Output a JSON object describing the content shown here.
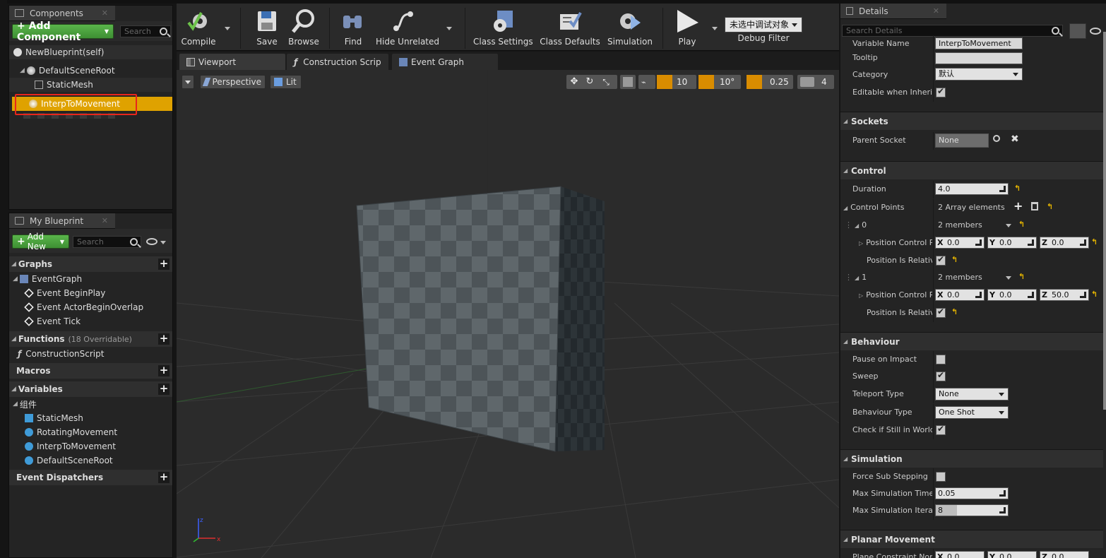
{
  "components_panel": {
    "tab_title": "Components",
    "add_component_label": "+ Add Component",
    "search_placeholder": "Search",
    "self_item": "NewBlueprint(self)",
    "tree": [
      {
        "label": "DefaultSceneRoot"
      },
      {
        "label": "StaticMesh"
      },
      {
        "label": "InterpToMovement",
        "selected": true
      }
    ]
  },
  "my_blueprint": {
    "tab_title": "My Blueprint",
    "add_new_label": "Add New",
    "search_placeholder": "Search",
    "graphs_label": "Graphs",
    "event_graph": "EventGraph",
    "events": [
      "Event BeginPlay",
      "Event ActorBeginOverlap",
      "Event Tick"
    ],
    "functions_label": "Functions",
    "functions_count": "(18 Overridable)",
    "construction_script": "ConstructionScript",
    "macros_label": "Macros",
    "variables_label": "Variables",
    "components_group": "组件",
    "variables": [
      "StaticMesh",
      "RotatingMovement",
      "InterpToMovement",
      "DefaultSceneRoot"
    ],
    "dispatchers_label": "Event Dispatchers"
  },
  "toolbar": {
    "compile": "Compile",
    "save": "Save",
    "browse": "Browse",
    "find": "Find",
    "hide_unrelated": "Hide Unrelated",
    "class_settings": "Class Settings",
    "class_defaults": "Class Defaults",
    "simulation": "Simulation",
    "play": "Play",
    "debug_object": "未选中调试对象",
    "debug_filter": "Debug Filter"
  },
  "doc_tabs": [
    "Viewport",
    "Construction Scrip",
    "Event Graph"
  ],
  "viewport": {
    "perspective": "Perspective",
    "lit": "Lit",
    "grid_snap": "10",
    "rot_snap": "10°",
    "scale_snap": "0.25",
    "camera_speed": "4"
  },
  "details": {
    "tab_title": "Details",
    "search_placeholder": "Search Details",
    "variable_name_label": "Variable Name",
    "variable_name": "InterpToMovement",
    "tooltip_label": "Tooltip",
    "tooltip_value": "",
    "category_label": "Category",
    "category_value": "默认",
    "editable_label": "Editable when Inherited",
    "editable_checked": true,
    "sockets": {
      "title": "Sockets",
      "parent_socket_label": "Parent Socket",
      "parent_socket_value": "None"
    },
    "control": {
      "title": "Control",
      "duration_label": "Duration",
      "duration": "4.0",
      "control_points_label": "Control Points",
      "control_points_value": "2 Array elements",
      "points": [
        {
          "index": "0",
          "members": "2 members",
          "pos_label": "Position Control Point",
          "x": "0.0",
          "y": "0.0",
          "z": "0.0",
          "relative_label": "Position Is Relative",
          "relative": true
        },
        {
          "index": "1",
          "members": "2 members",
          "pos_label": "Position Control Point",
          "x": "0.0",
          "y": "0.0",
          "z": "50.0",
          "relative_label": "Position Is Relative",
          "relative": true
        }
      ]
    },
    "behaviour": {
      "title": "Behaviour",
      "pause_label": "Pause on Impact",
      "pause": false,
      "sweep_label": "Sweep",
      "sweep": true,
      "teleport_label": "Teleport Type",
      "teleport": "None",
      "behaviour_type_label": "Behaviour Type",
      "behaviour_type": "One Shot",
      "check_world_label": "Check if Still in World",
      "check_world": true
    },
    "simulation": {
      "title": "Simulation",
      "force_sub_label": "Force Sub Stepping",
      "force_sub": false,
      "max_time_label": "Max Simulation Time Step",
      "max_time": "0.05",
      "max_iter_label": "Max Simulation Iterations",
      "max_iter": "8"
    },
    "planar": {
      "title": "Planar Movement",
      "constraint_label": "Plane Constraint Normal",
      "x": "0.0",
      "y": "0.0",
      "z": "0.0"
    }
  },
  "colors": {
    "selection": "#dfa200",
    "highlight_box": "#e8261c",
    "green_button": "#4ba23f",
    "reset_arrow": "#e5b400"
  }
}
